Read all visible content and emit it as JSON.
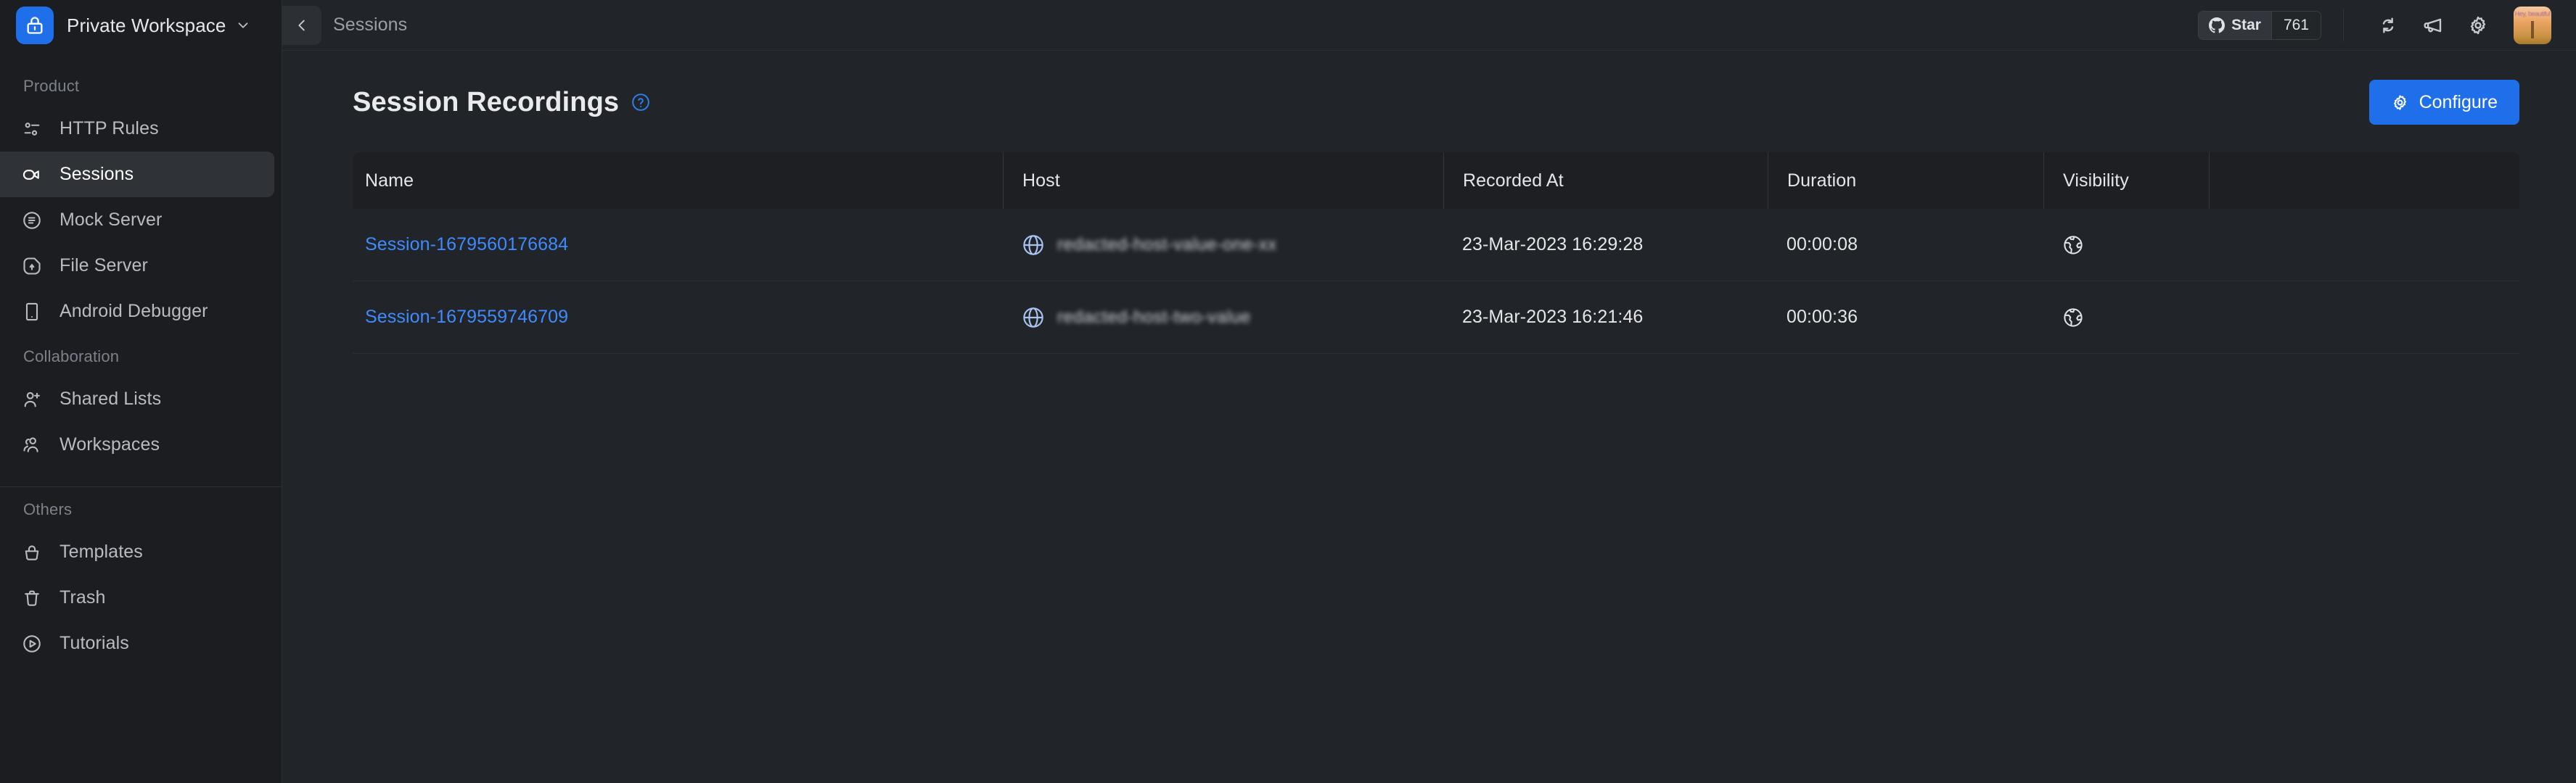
{
  "sidebar": {
    "workspace": {
      "name": "Private Workspace",
      "icon": "lock-icon",
      "caret": "chevron-down-icon"
    },
    "sections": [
      {
        "label": "Product",
        "items": [
          {
            "label": "HTTP Rules",
            "icon": "http-rules-icon",
            "active": false
          },
          {
            "label": "Sessions",
            "icon": "video-camera-icon",
            "active": true
          },
          {
            "label": "Mock Server",
            "icon": "mock-server-icon",
            "active": false
          },
          {
            "label": "File Server",
            "icon": "file-server-icon",
            "active": false
          },
          {
            "label": "Android Debugger",
            "icon": "mobile-device-icon",
            "active": false
          }
        ]
      },
      {
        "label": "Collaboration",
        "items": [
          {
            "label": "Shared Lists",
            "icon": "user-add-icon",
            "active": false
          },
          {
            "label": "Workspaces",
            "icon": "users-group-icon",
            "active": false
          }
        ]
      },
      {
        "label": "Others",
        "items": [
          {
            "label": "Templates",
            "icon": "templates-icon",
            "active": false
          },
          {
            "label": "Trash",
            "icon": "trash-icon",
            "active": false
          },
          {
            "label": "Tutorials",
            "icon": "play-circle-icon",
            "active": false
          }
        ]
      }
    ],
    "collapse_icon": "chevron-left-icon"
  },
  "topbar": {
    "back_icon": "arrow-left-icon",
    "breadcrumb": "Sessions",
    "star": {
      "icon": "github-icon",
      "label": "Star",
      "count": "761"
    },
    "icons": [
      {
        "name": "sync-icon"
      },
      {
        "name": "megaphone-icon"
      },
      {
        "name": "gear-icon"
      }
    ],
    "avatar": {
      "name": "user-avatar",
      "overlay_text": "Hey, beautiful"
    }
  },
  "main": {
    "title": "Session Recordings",
    "help_icon": "help-circle-icon",
    "configure": {
      "label": "Configure",
      "icon": "gear-icon"
    },
    "table": {
      "columns": [
        "Name",
        "Host",
        "Recorded At",
        "Duration",
        "Visibility",
        ""
      ],
      "rows": [
        {
          "name": "Session-1679560176684",
          "host": "redacted-host-value-one-xx",
          "recorded_at": "23-Mar-2023 16:29:28",
          "duration": "00:00:08",
          "visibility_icon": "globe-icon"
        },
        {
          "name": "Session-1679559746709",
          "host": "redacted-host-two-value",
          "recorded_at": "23-Mar-2023 16:21:46",
          "duration": "00:00:36",
          "visibility_icon": "globe-icon"
        }
      ]
    }
  },
  "colors": {
    "accent": "#1f6feb",
    "link": "#3d8bfd",
    "sidebar_bg": "#1b1d21",
    "main_bg": "#212429",
    "table_header_bg": "#1d1f22",
    "active_item_bg": "#2f3236"
  }
}
